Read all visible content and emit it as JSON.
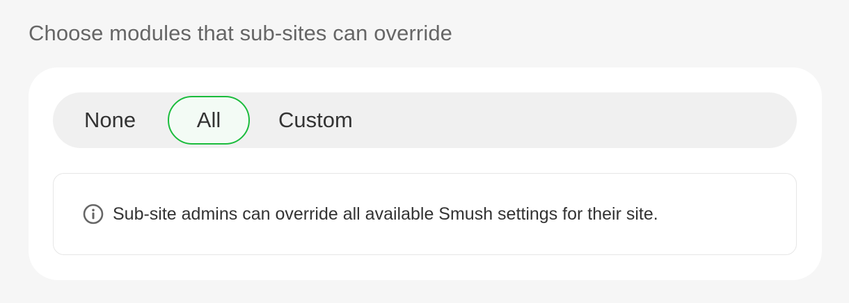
{
  "section": {
    "heading": "Choose modules that sub-sites can override"
  },
  "segmented_control": {
    "options": [
      "None",
      "All",
      "Custom"
    ],
    "selected": "All"
  },
  "notice": {
    "icon": "info-icon",
    "text": "Sub-site admins can override all available Smush settings for their site."
  },
  "colors": {
    "page_bg": "#f6f6f6",
    "card_bg": "#ffffff",
    "segmented_bg": "#f0f0f0",
    "selected_border": "#1abc3c",
    "selected_bg": "#f3fbf5",
    "heading_text": "#666666",
    "body_text": "#333333"
  }
}
